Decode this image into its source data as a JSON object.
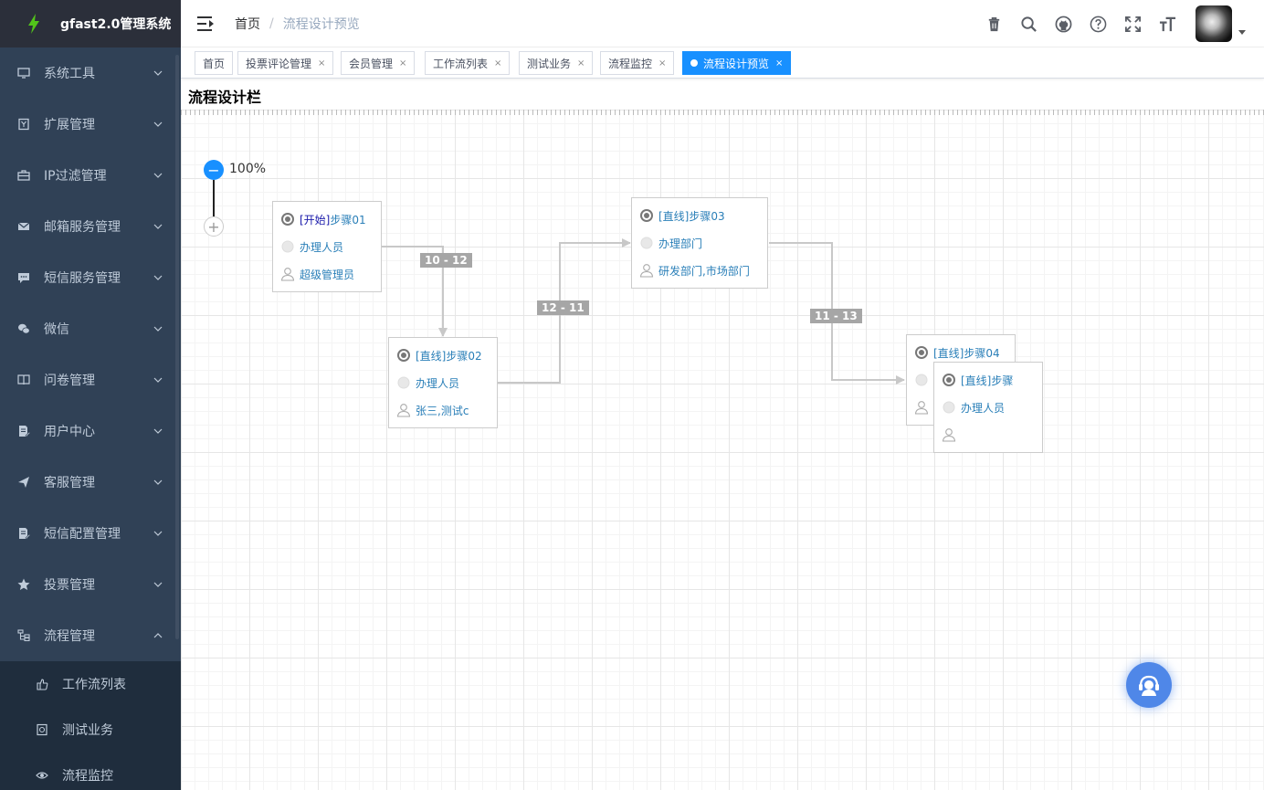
{
  "app": {
    "title": "gfast2.0管理系统"
  },
  "sidebar": {
    "items": [
      {
        "label": "系统工具",
        "icon": "monitor-icon"
      },
      {
        "label": "扩展管理",
        "icon": "extension-icon"
      },
      {
        "label": "IP过滤管理",
        "icon": "briefcase-icon"
      },
      {
        "label": "邮箱服务管理",
        "icon": "mail-icon"
      },
      {
        "label": "短信服务管理",
        "icon": "message-icon"
      },
      {
        "label": "微信",
        "icon": "wechat-icon"
      },
      {
        "label": "问卷管理",
        "icon": "book-icon"
      },
      {
        "label": "用户中心",
        "icon": "document-edit-icon"
      },
      {
        "label": "客服管理",
        "icon": "send-icon"
      },
      {
        "label": "短信配置管理",
        "icon": "document-edit-icon"
      },
      {
        "label": "投票管理",
        "icon": "star-icon"
      },
      {
        "label": "流程管理",
        "icon": "tree-icon"
      }
    ],
    "subitems": [
      {
        "label": "工作流列表",
        "icon": "hand-icon"
      },
      {
        "label": "测试业务",
        "icon": "camera-icon"
      },
      {
        "label": "流程监控",
        "icon": "eye-icon"
      }
    ]
  },
  "breadcrumb": {
    "home": "首页",
    "sep": "/",
    "current": "流程设计预览"
  },
  "tags": [
    {
      "label": "首页",
      "closable": false
    },
    {
      "label": "投票评论管理",
      "closable": true
    },
    {
      "label": "会员管理",
      "closable": true
    },
    {
      "label": "工作流列表",
      "closable": true
    },
    {
      "label": "测试业务",
      "closable": true
    },
    {
      "label": "流程监控",
      "closable": true
    },
    {
      "label": "流程设计预览",
      "closable": true,
      "active": true
    }
  ],
  "tag_close": "×",
  "canvas": {
    "title": "流程设计栏",
    "zoom": "100%",
    "zoom_minus": "−",
    "zoom_plus": "+"
  },
  "nodes": [
    {
      "id": "step01",
      "type_label": "[开始]",
      "name": "步骤01",
      "handler_label": "办理人员",
      "handler": "超级管理员"
    },
    {
      "id": "step02",
      "type_label": "[直线]",
      "name": "步骤02",
      "handler_label": "办理人员",
      "handler": "张三,测试c"
    },
    {
      "id": "step03",
      "type_label": "[直线]",
      "name": "步骤03",
      "handler_label": "办理部门",
      "handler": "研发部门,市场部门"
    },
    {
      "id": "step04",
      "type_label": "[直线]",
      "name": "步骤04",
      "handler_label": "",
      "handler": ""
    },
    {
      "id": "step05",
      "type_label": "[直线]",
      "name": "步骤",
      "handler_label": "办理人员",
      "handler": ""
    }
  ],
  "connections": [
    {
      "label": "10 - 12"
    },
    {
      "label": "12 - 11"
    },
    {
      "label": "11 - 13"
    }
  ],
  "colors": {
    "accent": "#1890ff",
    "sidebar_bg": "#304156",
    "submenu_bg": "#1f2d3d",
    "link": "#2a7fb8"
  }
}
